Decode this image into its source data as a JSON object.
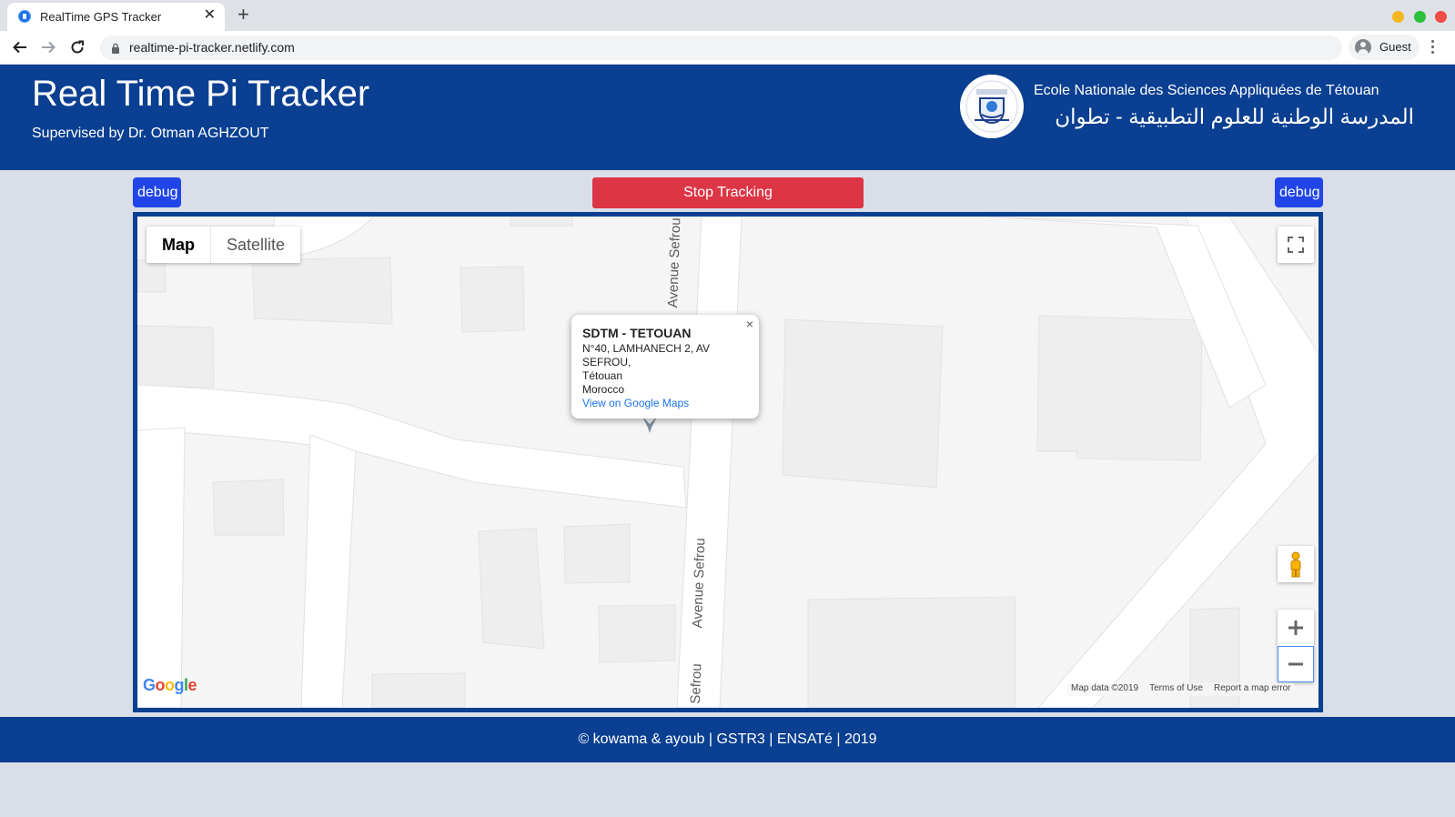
{
  "browser": {
    "tab_title": "RealTime GPS Tracker",
    "tab_close": "✕",
    "new_tab": "+",
    "url": "realtime-pi-tracker.netlify.com",
    "profile_label": "Guest"
  },
  "header": {
    "title": "Real Time Pi Tracker",
    "subtitle": "Supervised by Dr. Otman AGHZOUT",
    "school_name_fr": "Ecole Nationale des Sciences Appliquées de Tétouan",
    "school_name_ar": "المدرسة الوطنية للعلوم التطبيقية - تطوان"
  },
  "actions": {
    "debug_left": "debug",
    "stop_tracking": "Stop Tracking",
    "debug_right": "debug"
  },
  "map": {
    "map_type_map": "Map",
    "map_type_satellite": "Satellite",
    "street_label_top": "Avenue Sefrou",
    "street_label_middle": "Avenue Sefrou",
    "street_label_bottom": "Avenue Sefrou",
    "info_window": {
      "title": "SDTM - TETOUAN",
      "lines": [
        "N°40, LAMHANECH 2, AV",
        "SEFROU,",
        "Tétouan",
        "Morocco"
      ],
      "link": "View on Google Maps",
      "close": "×"
    },
    "google_logo": "Google",
    "attribution": [
      "Map data ©2019",
      "Terms of Use",
      "Report a map error"
    ]
  },
  "footer": {
    "text": "© kowama & ayoub | GSTR3 | ENSATé | 2019"
  },
  "colors": {
    "brand_blue": "#0a3f91",
    "debug_blue": "#2145e9",
    "stop_red": "#dc3545",
    "page_bg": "#d9dee9"
  }
}
